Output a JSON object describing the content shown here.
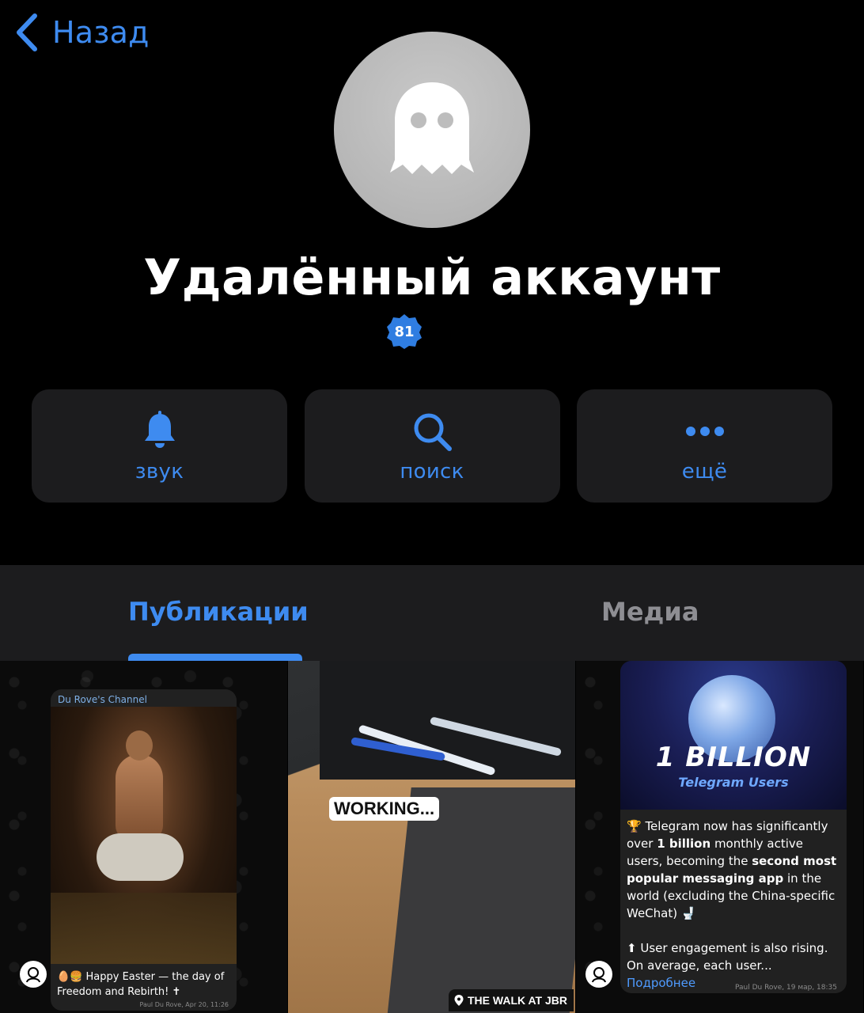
{
  "nav": {
    "back_label": "Назад"
  },
  "profile": {
    "name": "Удалённый аккаунт",
    "badge_count": "81"
  },
  "actions": [
    {
      "label": "звук",
      "icon": "bell-icon"
    },
    {
      "label": "поиск",
      "icon": "search-icon"
    },
    {
      "label": "ещё",
      "icon": "more-icon"
    }
  ],
  "tabs": {
    "publications": "Публикации",
    "media": "Медиа",
    "active": "publications"
  },
  "posts": [
    {
      "channel": "Du Rove's Channel",
      "caption": "🥚🍔 Happy Easter — the day of Freedom and Rebirth! ✝",
      "meta": "Paul Du Rove, Apr 20, 11:26"
    },
    {
      "overlay": "WORKING...",
      "location": "THE WALK AT JBR"
    },
    {
      "banner_title": "1 BILLION",
      "banner_subtitle": "Telegram Users",
      "paragraph1_pre": "🏆 Telegram now has significantly over ",
      "paragraph1_b1": "1 billion",
      "paragraph1_mid": " monthly active users, becoming the ",
      "paragraph1_b2": "second most popular messaging app",
      "paragraph1_post": " in the world (excluding the China-specific WeChat) 🚽",
      "paragraph2": "⬆ User engagement is also rising. On average, each user... ",
      "more": "Подробнее",
      "meta": "Paul Du Rove, 19 мар, 18:35"
    }
  ],
  "colors": {
    "accent": "#3e8bf0",
    "background": "#000000",
    "surface": "#1c1c1e",
    "inactive_tab": "#8e8e93"
  }
}
